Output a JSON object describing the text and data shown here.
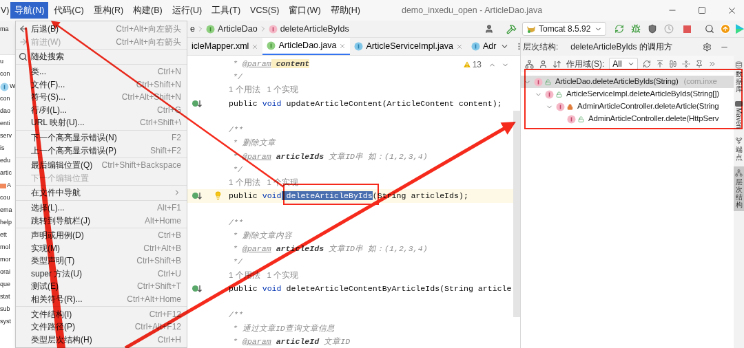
{
  "menu_bar": {
    "cut_item": "V)",
    "items": [
      {
        "label": "导航(N)",
        "selected": true
      },
      {
        "label": "代码(C)",
        "selected": false
      },
      {
        "label": "重构(R)",
        "selected": false
      },
      {
        "label": "构建(B)",
        "selected": false
      },
      {
        "label": "运行(U)",
        "selected": false
      },
      {
        "label": "工具(T)",
        "selected": false
      },
      {
        "label": "VCS(S)",
        "selected": false
      },
      {
        "label": "窗口(W)",
        "selected": false
      },
      {
        "label": "帮助(H)",
        "selected": false
      }
    ],
    "title": "demo_inxedu_open - ArticleDao.java"
  },
  "project_tree": {
    "header_fragment": "ma",
    "fragments": [
      {
        "text": "u",
        "kind": "plain"
      },
      {
        "text": "con",
        "kind": "plain"
      },
      {
        "text": "W",
        "kind": "enum"
      },
      {
        "text": "con",
        "kind": "plain"
      },
      {
        "text": "dao",
        "kind": "plain"
      },
      {
        "text": "enti",
        "kind": "plain"
      },
      {
        "text": "serv",
        "kind": "plain"
      },
      {
        "text": "is",
        "kind": "plain"
      },
      {
        "text": "edu",
        "kind": "plain"
      },
      {
        "text": "artic",
        "kind": "plain"
      },
      {
        "text": "A",
        "kind": "xml"
      },
      {
        "text": "cou",
        "kind": "plain"
      },
      {
        "text": "ema",
        "kind": "plain"
      },
      {
        "text": "help",
        "kind": "plain"
      },
      {
        "text": "ett",
        "kind": "plain"
      },
      {
        "text": "mol",
        "kind": "plain"
      },
      {
        "text": "mor",
        "kind": "plain"
      },
      {
        "text": "orai",
        "kind": "plain"
      },
      {
        "text": "que",
        "kind": "plain"
      },
      {
        "text": "stat",
        "kind": "plain"
      },
      {
        "text": "sub",
        "kind": "plain"
      },
      {
        "text": "syst",
        "kind": "plain"
      }
    ]
  },
  "nav_menu": {
    "items": [
      {
        "kind": "back",
        "label": "后退(B)",
        "shortcut": "Ctrl+Alt+向左箭头",
        "disabled": false
      },
      {
        "kind": "forward",
        "label": "前进(W)",
        "shortcut": "Ctrl+Alt+向右箭头",
        "disabled": true
      },
      {
        "kind": "separator"
      },
      {
        "kind": "search",
        "label": "随处搜索",
        "disabled": false
      },
      {
        "kind": "separator"
      },
      {
        "kind": "item",
        "label": "类...",
        "shortcut": "Ctrl+N",
        "disabled": false
      },
      {
        "kind": "item",
        "label": "文件(F)...",
        "shortcut": "Ctrl+Shift+N",
        "disabled": false
      },
      {
        "kind": "item",
        "label": "符号(S)...",
        "shortcut": "Ctrl+Alt+Shift+N",
        "disabled": false
      },
      {
        "kind": "item",
        "label": "行/列(L)...",
        "shortcut": "Ctrl+G",
        "disabled": false
      },
      {
        "kind": "item",
        "label": "URL 映射(U)...",
        "shortcut": "Ctrl+Shift+\\",
        "disabled": false
      },
      {
        "kind": "separator"
      },
      {
        "kind": "item",
        "label": "下一个高亮显示错误(N)",
        "shortcut": "F2",
        "disabled": false
      },
      {
        "kind": "item",
        "label": "上一个高亮显示错误(P)",
        "shortcut": "Shift+F2",
        "disabled": false
      },
      {
        "kind": "separator"
      },
      {
        "kind": "item",
        "label": "最后编辑位置(Q)",
        "shortcut": "Ctrl+Shift+Backspace",
        "disabled": false
      },
      {
        "kind": "item",
        "label": "下一个编辑位置",
        "disabled": true
      },
      {
        "kind": "separator"
      },
      {
        "kind": "submenu",
        "label": "在文件中导航",
        "disabled": false
      },
      {
        "kind": "separator"
      },
      {
        "kind": "item",
        "label": "选择(L)...",
        "shortcut": "Alt+F1",
        "disabled": false
      },
      {
        "kind": "item",
        "label": "跳转到导航栏(J)",
        "shortcut": "Alt+Home",
        "disabled": false
      },
      {
        "kind": "separator"
      },
      {
        "kind": "item",
        "label": "声明或用例(D)",
        "shortcut": "Ctrl+B",
        "disabled": false
      },
      {
        "kind": "item",
        "label": "实现(M)",
        "shortcut": "Ctrl+Alt+B",
        "disabled": false
      },
      {
        "kind": "item",
        "label": "类型声明(T)",
        "shortcut": "Ctrl+Shift+B",
        "disabled": false
      },
      {
        "kind": "item",
        "label": "super 方法(U)",
        "shortcut": "Ctrl+U",
        "disabled": false
      },
      {
        "kind": "item",
        "label": "测试(E)",
        "shortcut": "Ctrl+Shift+T",
        "disabled": false
      },
      {
        "kind": "item",
        "label": "相关符号(R)...",
        "shortcut": "Ctrl+Alt+Home",
        "disabled": false
      },
      {
        "kind": "separator"
      },
      {
        "kind": "item",
        "label": "文件结构(I)",
        "shortcut": "Ctrl+F12",
        "disabled": false
      },
      {
        "kind": "item",
        "label": "文件路径(P)",
        "shortcut": "Ctrl+Alt+F12",
        "disabled": false
      },
      {
        "kind": "item",
        "label": "类型层次结构(H)",
        "shortcut": "Ctrl+H",
        "disabled": false
      }
    ]
  },
  "breadcrumb": [
    {
      "kind": "plain",
      "label": "e"
    },
    {
      "kind": "interface",
      "label": "ArticleDao"
    },
    {
      "kind": "method",
      "label": "deleteArticleByIds"
    }
  ],
  "run_config": "Tomcat 8.5.92",
  "tabs": [
    {
      "label": "icleMapper.xml",
      "kind": "cut",
      "selected": false,
      "closable": true
    },
    {
      "label": "ArticleDao.java",
      "kind": "interface",
      "selected": true,
      "closable": true
    },
    {
      "label": "ArticleServiceImpl.java",
      "kind": "class",
      "selected": false,
      "closable": true
    },
    {
      "label": "Adr",
      "kind": "class",
      "selected": false,
      "closable": false
    }
  ],
  "editor": {
    "warnings": "13",
    "lines": [
      {
        "kind": "doc",
        "current": false,
        "segments": [
          {
            "text": "* ",
            "kind": "doc"
          },
          {
            "text": "@param",
            "kind": "tag"
          },
          {
            "text": " content",
            "kind": "param-hl"
          }
        ]
      },
      {
        "kind": "doc",
        "current": false,
        "segments": [
          {
            "text": "*/",
            "kind": "doc"
          }
        ]
      },
      {
        "kind": "hints",
        "current": false,
        "hints": [
          "1 个用法",
          "1 个实现"
        ]
      },
      {
        "kind": "code",
        "current": false,
        "implemented": true,
        "segments": [
          {
            "text": "public ",
            "kind": "plain"
          },
          {
            "text": "void",
            "kind": "keyword"
          },
          {
            "text": " updateArticleContent(ArticleContent content);",
            "kind": "plain"
          }
        ]
      },
      {
        "kind": "blank",
        "current": false
      },
      {
        "kind": "doc-start",
        "current": false,
        "segments": [
          {
            "text": "/**",
            "kind": "doc"
          }
        ]
      },
      {
        "kind": "doc",
        "current": false,
        "segments": [
          {
            "text": "* 删除文章",
            "kind": "doc"
          }
        ]
      },
      {
        "kind": "doc",
        "current": false,
        "segments": [
          {
            "text": "* ",
            "kind": "doc"
          },
          {
            "text": "@param",
            "kind": "tag"
          },
          {
            "text": " articleIds",
            "kind": "param"
          },
          {
            "text": " 文章ID串 如：(1,2,3,4)",
            "kind": "doc"
          }
        ]
      },
      {
        "kind": "doc",
        "current": false,
        "segments": [
          {
            "text": "*/",
            "kind": "doc"
          }
        ]
      },
      {
        "kind": "hints",
        "current": false,
        "hints": [
          "1 个用法",
          "1 个实现"
        ]
      },
      {
        "kind": "code",
        "current": true,
        "implemented": true,
        "intention": true,
        "segments": [
          {
            "text": "public ",
            "kind": "plain"
          },
          {
            "text": "void",
            "kind": "keyword"
          },
          {
            "text": " deleteArticleByIds",
            "kind": "selected"
          },
          {
            "text": "(String articleIds);",
            "kind": "plain"
          }
        ]
      },
      {
        "kind": "blank",
        "current": false
      },
      {
        "kind": "doc-start",
        "current": false,
        "segments": [
          {
            "text": "/**",
            "kind": "doc"
          }
        ]
      },
      {
        "kind": "doc",
        "current": false,
        "segments": [
          {
            "text": "* 删除文章内容",
            "kind": "doc"
          }
        ]
      },
      {
        "kind": "doc",
        "current": false,
        "segments": [
          {
            "text": "* ",
            "kind": "doc"
          },
          {
            "text": "@param",
            "kind": "tag"
          },
          {
            "text": " articleIds",
            "kind": "param"
          },
          {
            "text": " 文章ID串 如：(1,2,3,4)",
            "kind": "doc"
          }
        ]
      },
      {
        "kind": "doc",
        "current": false,
        "segments": [
          {
            "text": "*/",
            "kind": "doc"
          }
        ]
      },
      {
        "kind": "hints",
        "current": false,
        "hints": [
          "1 个用法",
          "1 个实现"
        ]
      },
      {
        "kind": "code",
        "current": false,
        "implemented": true,
        "segments": [
          {
            "text": "public ",
            "kind": "plain"
          },
          {
            "text": "void",
            "kind": "keyword"
          },
          {
            "text": " deleteArticleContentByArticleIds(String article",
            "kind": "plain"
          }
        ]
      },
      {
        "kind": "blank",
        "current": false
      },
      {
        "kind": "doc-start",
        "current": false,
        "segments": [
          {
            "text": "/**",
            "kind": "doc"
          }
        ]
      },
      {
        "kind": "doc",
        "current": false,
        "segments": [
          {
            "text": "* 通过文章ID查询文章信息",
            "kind": "doc"
          }
        ]
      },
      {
        "kind": "doc",
        "current": false,
        "segments": [
          {
            "text": "* ",
            "kind": "doc"
          },
          {
            "text": "@param",
            "kind": "tag"
          },
          {
            "text": " articleId",
            "kind": "param"
          },
          {
            "text": " 文章ID",
            "kind": "doc"
          }
        ]
      }
    ]
  },
  "hierarchy": {
    "title": "层次结构:",
    "subject": "deleteArticleByIds 的调用方",
    "scope_label": "作用域(S):",
    "scope_value": "All",
    "tree": [
      {
        "label": "ArticleDao.deleteArticleByIds(String)",
        "package": "(com.inxe",
        "locked": false,
        "selected": true,
        "expanded": true,
        "children": [
          {
            "label": "ArticleServiceImpl.deleteArticleByIds(String[])",
            "locked": false,
            "selected": false,
            "expanded": true,
            "children": [
              {
                "label": "AdminArticleController.deleteArticle(String",
                "locked": true,
                "selected": false,
                "expanded": true,
                "children": [
                  {
                    "label": "AdminArticleController.delete(HttpServ",
                    "locked": false,
                    "selected": false
                  }
                ]
              }
            ]
          }
        ]
      }
    ]
  },
  "side_tabs": [
    {
      "label": "数据库",
      "kind": "cjk",
      "selected": false
    },
    {
      "label": "Maven",
      "kind": "latin",
      "selected": false
    },
    {
      "label": "端点",
      "kind": "cjk",
      "selected": false
    },
    {
      "label": "层次结构",
      "kind": "cjk",
      "selected": true
    }
  ]
}
